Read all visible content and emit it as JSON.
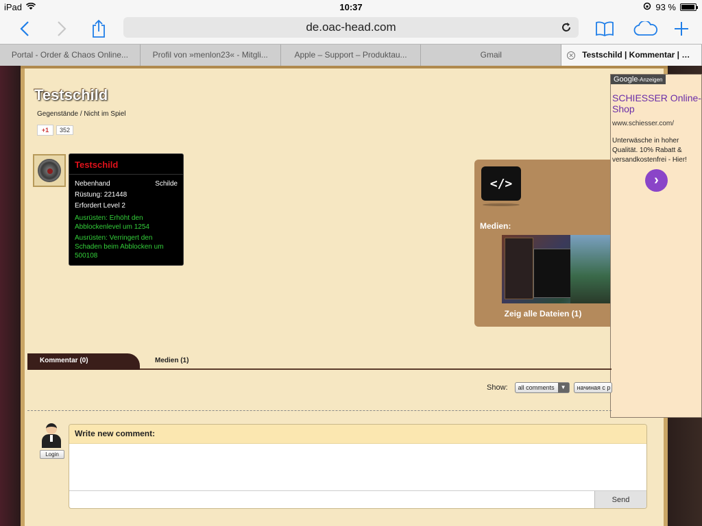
{
  "status_bar": {
    "device": "iPad",
    "time": "10:37",
    "battery": "93 %"
  },
  "browser": {
    "url": "de.oac-head.com",
    "tabs": [
      {
        "label": "Portal - Order & Chaos Online..."
      },
      {
        "label": "Profil von »menlon23« - Mitgli..."
      },
      {
        "label": "Apple – Support – Produktau..."
      },
      {
        "label": "Gmail"
      },
      {
        "label": "Testschild | Kommentar | O..."
      }
    ]
  },
  "item": {
    "title": "Testschild",
    "breadcrumb": "Gegenstände / Nicht im Spiel",
    "gplus_label": "+1",
    "gplus_count": "352",
    "tooltip": {
      "name": "Testschild",
      "slot": "Nebenhand",
      "type": "Schilde",
      "armor": "Rüstung: 221448",
      "level": "Erfordert Level 2",
      "effect1": "Ausrüsten: Erhöht den Abblockenlevel um 1254",
      "effect2": "Ausrüsten: Verringert den Schaden beim Abblocken um 500108"
    }
  },
  "media": {
    "embed_label": "</>",
    "label": "Medien:",
    "show_all": "Zeig alle Dateien (1)"
  },
  "ad": {
    "tag": "Google",
    "tag_suffix": "-Anzeigen",
    "title": "SCHIESSER Online-Shop",
    "url": "www.schiesser.com/",
    "description": "Unterwäsche in hoher Qualität. 10% Rabatt & versandkostenfrei - Hier!",
    "arrow": "›"
  },
  "comments": {
    "tab_active": "Kommentar (0)",
    "tab_media": "Medien (1)",
    "show_label": "Show:",
    "filter_value": "all comments",
    "sort_value": "начиная с р",
    "login_label": "Login",
    "write_label": "Write new comment:",
    "send_label": "Send"
  },
  "colors": {
    "parchment": "#f6e7c2",
    "item_name_red": "#e0121b",
    "effect_green": "#33d03a",
    "ad_purple": "#6a2da8",
    "safari_blue": "#1f7ee8"
  }
}
